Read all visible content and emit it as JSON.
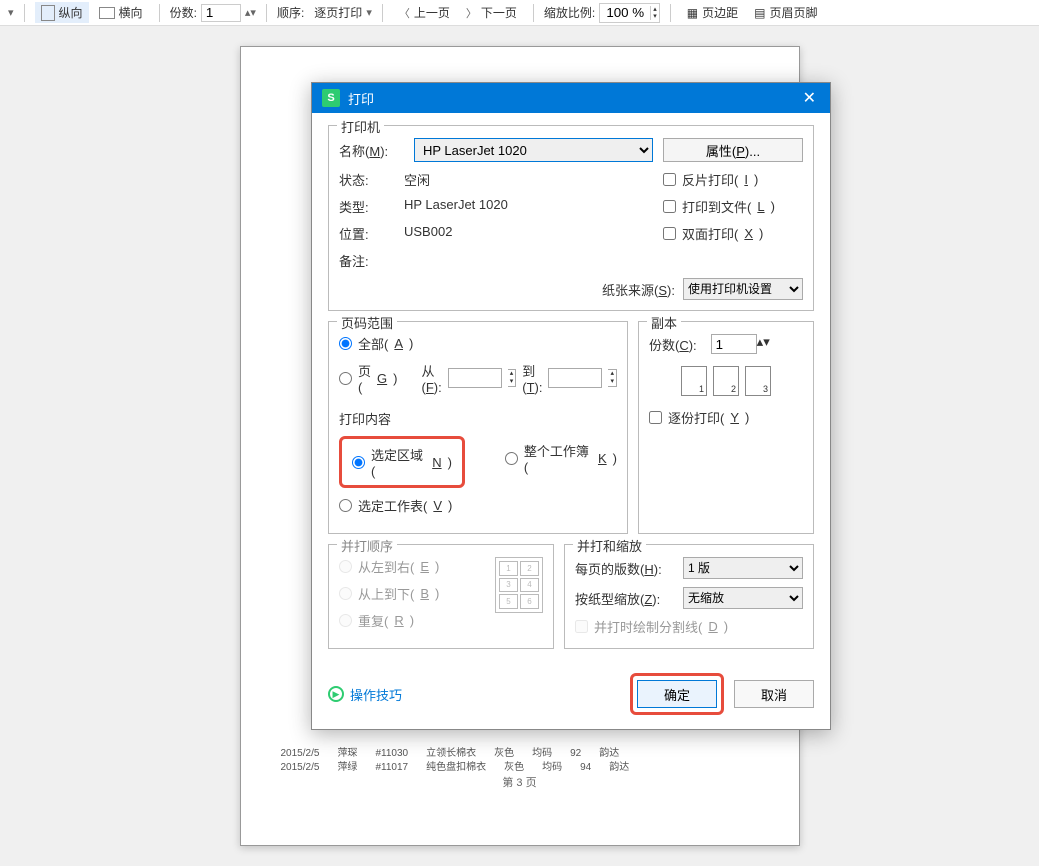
{
  "toolbar": {
    "portrait": "纵向",
    "landscape": "横向",
    "copies_label": "份数:",
    "copies_value": "1",
    "order_label": "顺序:",
    "order_value": "逐页打印",
    "prev_page": "上一页",
    "next_page": "下一页",
    "zoom_label": "缩放比例:",
    "zoom_value": "100 %",
    "margins_btn": "页边距",
    "header_footer_btn": "页眉页脚"
  },
  "page_preview": {
    "footer": "第 3 页",
    "rows": [
      [
        "2015/2/5",
        "萍琛",
        "#11030",
        "立领长棉衣",
        "灰色",
        "均码",
        "92",
        "韵达"
      ],
      [
        "2015/2/5",
        "萍绿",
        "#11017",
        "纯色盘扣棉衣",
        "灰色",
        "均码",
        "94",
        "韵达"
      ]
    ]
  },
  "dialog": {
    "title": "打印",
    "printer_group": "打印机",
    "name_label": "名称(M):",
    "name_value": "HP LaserJet 1020",
    "properties_btn": "属性(P)...",
    "status_label": "状态:",
    "status_value": "空闲",
    "type_label": "类型:",
    "type_value": "HP LaserJet 1020",
    "location_label": "位置:",
    "location_value": "USB002",
    "comment_label": "备注:",
    "reverse_print": "反片打印(I)",
    "print_to_file": "打印到文件(L)",
    "duplex": "双面打印(X)",
    "paper_source_label": "纸张来源(S):",
    "paper_source_value": "使用打印机设置",
    "range_group": "页码范围",
    "range_all": "全部(A)",
    "range_pages": "页(G)",
    "from_label": "从(F):",
    "to_label": "到(T):",
    "content_group": "打印内容",
    "content_selection": "选定区域(N)",
    "content_workbook": "整个工作簿(K)",
    "content_sheet": "选定工作表(V)",
    "copies_group": "副本",
    "copies_label": "份数(C):",
    "copies_value": "1",
    "collate": "逐份打印(Y)",
    "order_group": "并打顺序",
    "order_ltr": "从左到右(E)",
    "order_ttb": "从上到下(B)",
    "order_repeat": "重复(R)",
    "scale_group": "并打和缩放",
    "pages_per_sheet_label": "每页的版数(H):",
    "pages_per_sheet_value": "1 版",
    "scale_label": "按纸型缩放(Z):",
    "scale_value": "无缩放",
    "cut_lines": "并打时绘制分割线(D)",
    "tips": "操作技巧",
    "ok": "确定",
    "cancel": "取消"
  }
}
